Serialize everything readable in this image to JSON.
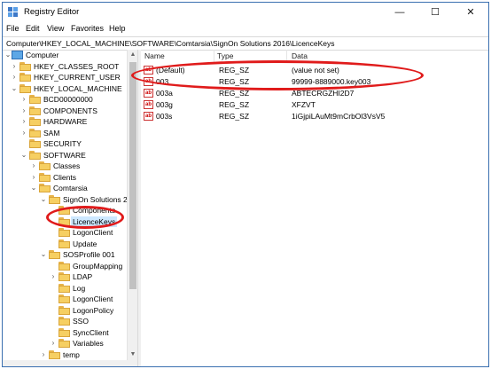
{
  "window": {
    "title": "Registry Editor",
    "controls": {
      "minimize": "—",
      "maximize": "☐",
      "close": "✕"
    }
  },
  "menu": [
    "File",
    "Edit",
    "View",
    "Favorites",
    "Help"
  ],
  "address": "Computer\\HKEY_LOCAL_MACHINE\\SOFTWARE\\Comtarsia\\SignOn Solutions 2016\\LicenceKeys",
  "tree": [
    {
      "label": "Computer",
      "expander": "⌄",
      "icon": "computer-icon"
    },
    {
      "label": "HKEY_CLASSES_ROOT",
      "expander": "›",
      "icon": "folder-icon"
    },
    {
      "label": "HKEY_CURRENT_USER",
      "expander": "›",
      "icon": "folder-icon"
    },
    {
      "label": "HKEY_LOCAL_MACHINE",
      "expander": "⌄",
      "icon": "folder-icon"
    },
    {
      "label": "BCD00000000",
      "expander": "›",
      "icon": "folder-icon"
    },
    {
      "label": "COMPONENTS",
      "expander": "›",
      "icon": "folder-icon"
    },
    {
      "label": "HARDWARE",
      "expander": "›",
      "icon": "folder-icon"
    },
    {
      "label": "SAM",
      "expander": "›",
      "icon": "folder-icon"
    },
    {
      "label": "SECURITY",
      "expander": "",
      "icon": "folder-icon"
    },
    {
      "label": "SOFTWARE",
      "expander": "⌄",
      "icon": "folder-icon"
    },
    {
      "label": "Classes",
      "expander": "›",
      "icon": "folder-icon"
    },
    {
      "label": "Clients",
      "expander": "›",
      "icon": "folder-icon"
    },
    {
      "label": "Comtarsia",
      "expander": "⌄",
      "icon": "folder-icon"
    },
    {
      "label": "SignOn Solutions 2",
      "expander": "⌄",
      "icon": "folder-icon"
    },
    {
      "label": "Components",
      "expander": "",
      "icon": "folder-icon"
    },
    {
      "label": "LicenceKeys",
      "expander": "",
      "icon": "folder-icon",
      "selected": true
    },
    {
      "label": "LogonClient",
      "expander": "",
      "icon": "folder-icon"
    },
    {
      "label": "Update",
      "expander": "",
      "icon": "folder-icon"
    },
    {
      "label": "SOSProfile 001",
      "expander": "⌄",
      "icon": "folder-icon"
    },
    {
      "label": "GroupMapping",
      "expander": "",
      "icon": "folder-icon"
    },
    {
      "label": "LDAP",
      "expander": "›",
      "icon": "folder-icon"
    },
    {
      "label": "Log",
      "expander": "",
      "icon": "folder-icon"
    },
    {
      "label": "LogonClient",
      "expander": "",
      "icon": "folder-icon"
    },
    {
      "label": "LogonPolicy",
      "expander": "",
      "icon": "folder-icon"
    },
    {
      "label": "SSO",
      "expander": "",
      "icon": "folder-icon"
    },
    {
      "label": "SyncClient",
      "expander": "",
      "icon": "folder-icon"
    },
    {
      "label": "Variables",
      "expander": "›",
      "icon": "folder-icon"
    },
    {
      "label": "temp",
      "expander": "›",
      "icon": "folder-icon"
    }
  ],
  "columns": {
    "name": "Name",
    "type": "Type",
    "data": "Data"
  },
  "values": [
    {
      "name": "(Default)",
      "type": "REG_SZ",
      "data": "(value not set)"
    },
    {
      "name": "003",
      "type": "REG_SZ",
      "data": "99999-8889000.key003"
    },
    {
      "name": "003a",
      "type": "REG_SZ",
      "data": "ABTECRGZHI2D7"
    },
    {
      "name": "003g",
      "type": "REG_SZ",
      "data": "XFZVT"
    },
    {
      "name": "003s",
      "type": "REG_SZ",
      "data": "1iGjpiLAuMt9mCrbOl3VsV5"
    }
  ],
  "colors": {
    "highlight": "#e01b1b",
    "selection": "#cde8ff",
    "folder": "#f6cf62"
  }
}
